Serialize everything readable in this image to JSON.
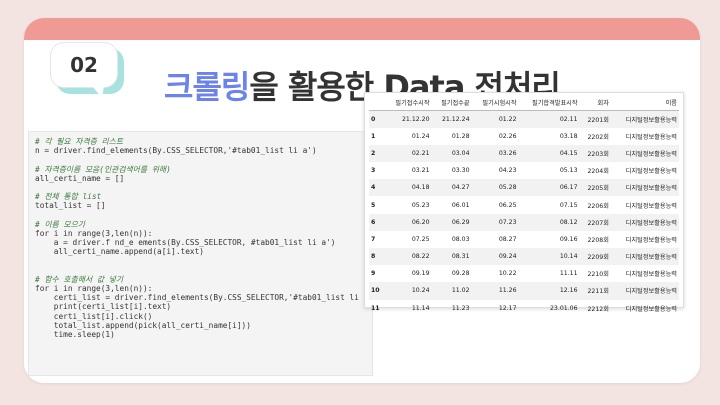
{
  "slide": {
    "number": "02",
    "title_accent": "크롤링",
    "title_rest": "을 활용한 Data 전처리"
  },
  "code_lines": [
    {
      "type": "comment",
      "text": "# 각 필요 자격증 리스트"
    },
    {
      "type": "code",
      "text": "n = driver.find_elements(By.CSS_SELECTOR,'#tab01_list li a')"
    },
    {
      "type": "gap",
      "text": ""
    },
    {
      "type": "comment",
      "text": "# 자격증이름 모음(인관검색어를 위해)"
    },
    {
      "type": "code",
      "text": "all_certi_name = []"
    },
    {
      "type": "gap",
      "text": ""
    },
    {
      "type": "comment",
      "text": "# 전체 통합 list"
    },
    {
      "type": "code",
      "text": "total_list = []"
    },
    {
      "type": "gap",
      "text": ""
    },
    {
      "type": "comment",
      "text": "# 이름 모으기"
    },
    {
      "type": "code",
      "text": "for i in range(3,len(n)):"
    },
    {
      "type": "code",
      "text": "    a = driver.f nd_e ements(By.CSS_SELECTOR, #tab01_list li a')"
    },
    {
      "type": "code",
      "text": "    all_certi_name.append(a[i].text)"
    },
    {
      "type": "gap",
      "text": ""
    },
    {
      "type": "gap",
      "text": ""
    },
    {
      "type": "comment",
      "text": "# 함수 호출해서 값 넣기"
    },
    {
      "type": "code",
      "text": "for i in range(3,len(n)):"
    },
    {
      "type": "code",
      "text": "    certi_list = driver.find_elements(By.CSS_SELECTOR,'#tab01_list li a')"
    },
    {
      "type": "code",
      "text": "    print(certi_list[i].text)"
    },
    {
      "type": "code",
      "text": "    certi_list[i].click()"
    },
    {
      "type": "code",
      "text": "    total_list.append(pick(all_certi_name[i]))"
    },
    {
      "type": "code",
      "text": "    time.sleep(1)"
    }
  ],
  "table": {
    "headers": [
      "",
      "필기접수시작",
      "필기접수끝",
      "필기시험시작",
      "필기합격발표시작",
      "회차",
      "이름"
    ],
    "rows": [
      [
        "0",
        "21.12.20",
        "21.12.24",
        "01.22",
        "02.11",
        "2201회",
        "디지털정보활용능력"
      ],
      [
        "1",
        "01.24",
        "01.28",
        "02.26",
        "03.18",
        "2202회",
        "디지털정보활용능력"
      ],
      [
        "2",
        "02.21",
        "03.04",
        "03.26",
        "04.15",
        "2203회",
        "디지털정보활용능력"
      ],
      [
        "3",
        "03.21",
        "03.30",
        "04.23",
        "05.13",
        "2204회",
        "디지털정보활용능력"
      ],
      [
        "4",
        "04.18",
        "04.27",
        "05.28",
        "06.17",
        "2205회",
        "디지털정보활용능력"
      ],
      [
        "5",
        "05.23",
        "06.01",
        "06.25",
        "07.15",
        "2206회",
        "디지털정보활용능력"
      ],
      [
        "6",
        "06.20",
        "06.29",
        "07.23",
        "08.12",
        "2207회",
        "디지털정보활용능력"
      ],
      [
        "7",
        "07.25",
        "08.03",
        "08.27",
        "09.16",
        "2208회",
        "디지털정보활용능력"
      ],
      [
        "8",
        "08.22",
        "08.31",
        "09.24",
        "10.14",
        "2209회",
        "디지털정보활용능력"
      ],
      [
        "9",
        "09.19",
        "09.28",
        "10.22",
        "11.11",
        "2210회",
        "디지털정보활용능력"
      ],
      [
        "10",
        "10.24",
        "11.02",
        "11.26",
        "12.16",
        "2211회",
        "디지털정보활용능력"
      ],
      [
        "11",
        "11.14",
        "11.23",
        "12.17",
        "23.01.06",
        "2212회",
        "디지털정보활용능력"
      ]
    ]
  },
  "colors": {
    "accent": "#6b83ea",
    "header_bar": "#ef9a94",
    "badge_shadow": "#a6e3df",
    "background": "#f3e4e2"
  }
}
